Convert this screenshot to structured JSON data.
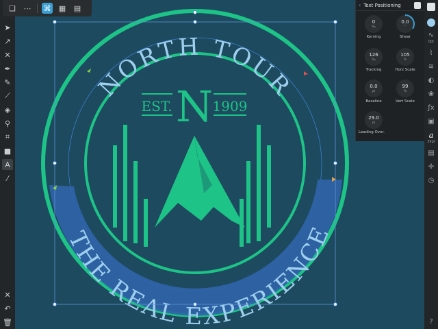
{
  "panel": {
    "title": "Text Positioning",
    "back_icon": "chevron-left-icon",
    "dials": [
      {
        "id": "kerning",
        "label": "Kerning",
        "value": "0",
        "unit": "‰"
      },
      {
        "id": "shear",
        "label": "Shear",
        "value": "0.0",
        "unit": "°"
      },
      {
        "id": "tracking",
        "label": "Tracking",
        "value": "126",
        "unit": "‰"
      },
      {
        "id": "horz-scale",
        "label": "Horz Scale",
        "value": "105",
        "unit": "%"
      },
      {
        "id": "baseline",
        "label": "Baseline",
        "value": "0.0",
        "unit": "pt"
      },
      {
        "id": "vert-scale",
        "label": "Vert Scale",
        "value": "99",
        "unit": "%"
      },
      {
        "id": "leading",
        "label": "Leading Over.",
        "value": "29.0",
        "unit": "pt"
      }
    ]
  },
  "studio": {
    "stroke_width": "0pt",
    "font_size": "39pt"
  },
  "logo": {
    "top_text": "NORTH TOUR",
    "bottom_text": "THE REAL EXPERIENCE",
    "est_label": "EST.",
    "initial": "N",
    "year": "1909"
  },
  "colors": {
    "canvas": "#1d4a5e",
    "green": "#1ec387",
    "text_light": "#9ecfee",
    "band": "#2f63a8",
    "accent": "#3a9fd3"
  }
}
